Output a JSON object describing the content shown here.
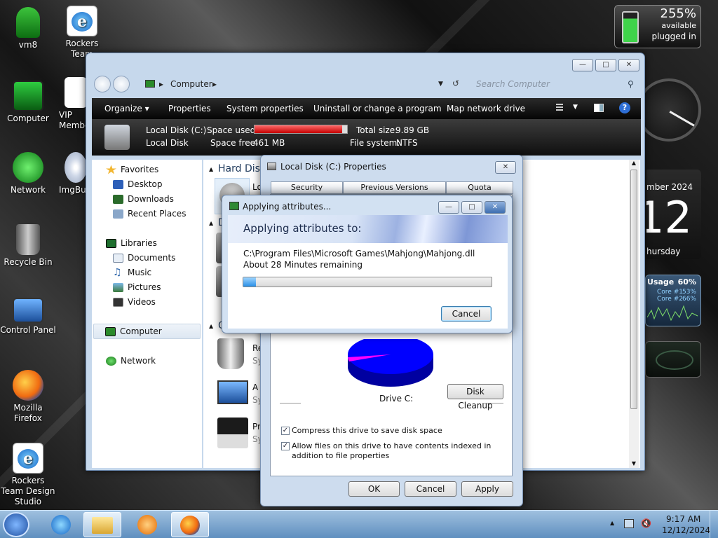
{
  "desktop": {
    "icons": [
      {
        "label": "vm8",
        "icon": "user-icon"
      },
      {
        "label": "Rockers Team",
        "icon": "ie-icon"
      },
      {
        "label": "Computer",
        "icon": "computer-icon"
      },
      {
        "label": "VIP Member",
        "icon": "ie-icon"
      },
      {
        "label": "Network",
        "icon": "network-icon"
      },
      {
        "label": "ImgBurn",
        "icon": "disc-icon"
      },
      {
        "label": "Recycle Bin",
        "icon": "recycle-bin-icon"
      },
      {
        "label": "Control Panel",
        "icon": "control-panel-icon"
      },
      {
        "label": "Mozilla Firefox",
        "icon": "firefox-icon"
      },
      {
        "label": "Rockers Team Design Studio",
        "icon": "ie-icon"
      }
    ]
  },
  "gadgets": {
    "battery": {
      "percent": "255%",
      "status1": "available",
      "status2": "plugged in"
    },
    "calendar": {
      "month": "mber 2024",
      "day": "12",
      "weekday": "hursday"
    },
    "cpu": {
      "title": "Usage",
      "total": "60%",
      "core1_label": "Core #1",
      "core1": "53%",
      "core2_label": "Core #2",
      "core2": "66%"
    }
  },
  "explorer": {
    "address": "Computer",
    "search_placeholder": "Search Computer",
    "toolbar": {
      "organize": "Organize",
      "properties": "Properties",
      "system_properties": "System properties",
      "uninstall": "Uninstall or change a program",
      "map_drive": "Map network drive"
    },
    "details": {
      "name": "Local Disk (C:)",
      "type": "Local Disk",
      "space_used_label": "Space used:",
      "space_used_fraction": 0.95,
      "space_free_label": "Space free:",
      "space_free": "461 MB",
      "total_size_label": "Total size:",
      "total_size": "9.89 GB",
      "fs_label": "File system:",
      "fs": "NTFS"
    },
    "nav": {
      "favorites": "Favorites",
      "desktop": "Desktop",
      "downloads": "Downloads",
      "recent": "Recent Places",
      "libraries": "Libraries",
      "documents": "Documents",
      "music": "Music",
      "pictures": "Pictures",
      "videos": "Videos",
      "computer": "Computer",
      "network": "Network"
    },
    "content": {
      "group_hard_disk": "Hard Dis",
      "item1": "Lo",
      "group_d": "D",
      "group_o": "O",
      "item_r": "Re",
      "item_r_sub": "Sy",
      "item_a": "A",
      "item_a_sub": "Sy",
      "item_p": "Pr",
      "item_p_sub": "Sy"
    }
  },
  "properties": {
    "title": "Local Disk (C:) Properties",
    "tabs": [
      "Security",
      "Previous Versions",
      "Quota"
    ],
    "drive_label": "Drive C:",
    "disk_cleanup": "Disk Cleanup",
    "compress": "Compress this drive to save disk space",
    "index": "Allow files on this drive to have contents indexed in addition to file properties",
    "ok": "OK",
    "cancel": "Cancel",
    "apply": "Apply",
    "colors": {
      "used": "#ff00ff",
      "free": "#0000ff"
    }
  },
  "applying": {
    "title": "Applying attributes...",
    "heading": "Applying attributes to:",
    "path": "C:\\Program Files\\Microsoft Games\\Mahjong\\Mahjong.dll",
    "remaining": "About 28 Minutes remaining",
    "progress": 0.05,
    "cancel": "Cancel"
  },
  "taskbar": {
    "time": "9:17 AM",
    "date": "12/12/2024"
  }
}
